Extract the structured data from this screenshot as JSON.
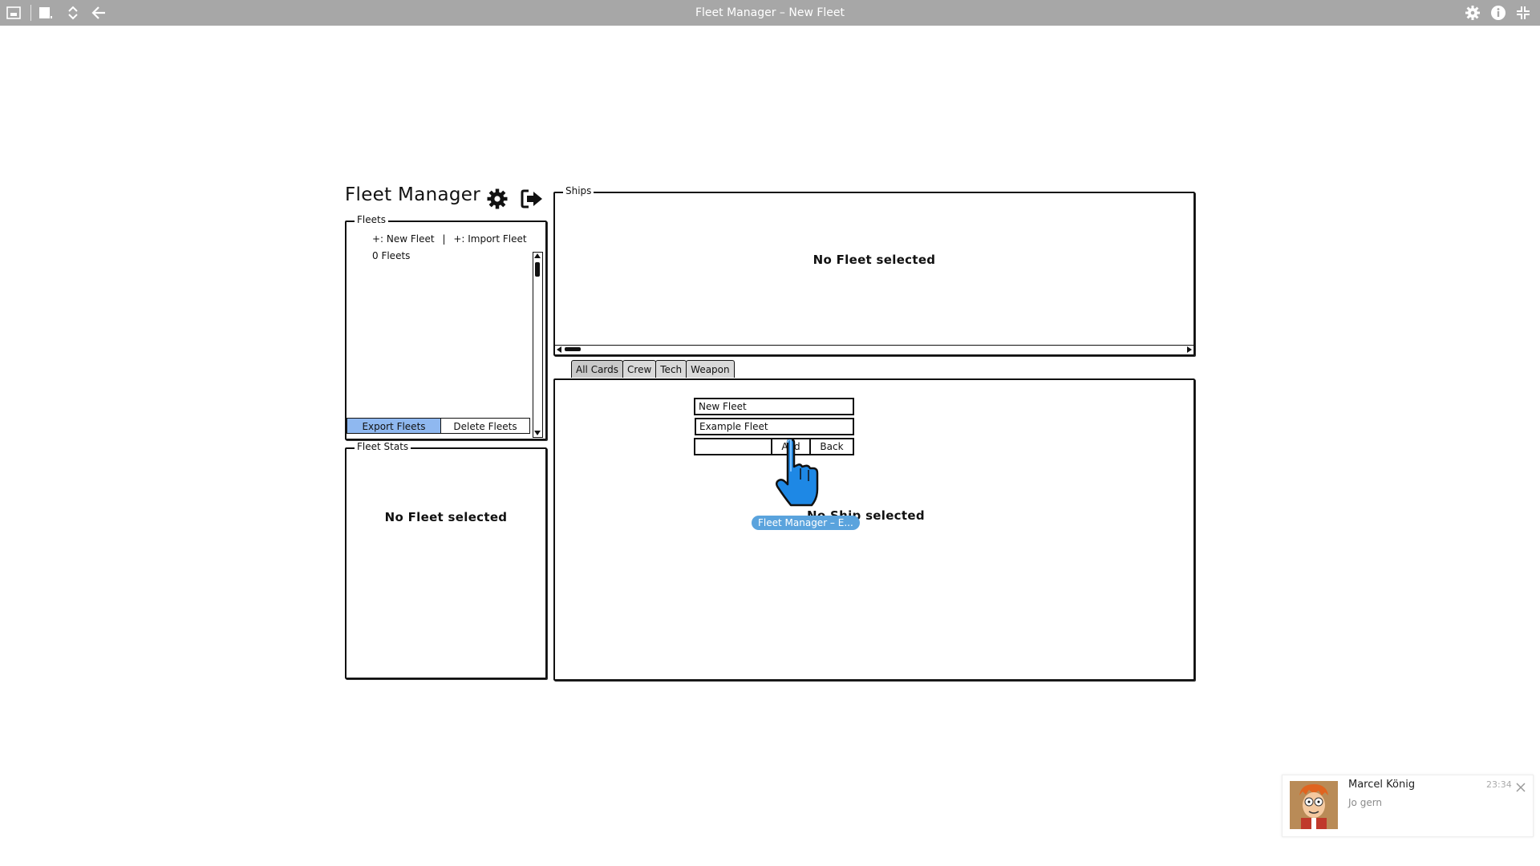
{
  "window": {
    "title": "Fleet Manager – New Fleet",
    "icons": [
      "window-menu-icon",
      "window-list-icon",
      "reorder-icon",
      "back-arrow-icon",
      "settings-icon",
      "info-icon",
      "collapse-icon"
    ]
  },
  "app": {
    "title": "Fleet Manager",
    "settings_icon": "gear-icon",
    "logout_icon": "logout-icon"
  },
  "fleets": {
    "legend": "Fleets",
    "new_fleet_link": "+: New Fleet",
    "separator": "|",
    "import_fleet_link": "+: Import Fleet",
    "count": "0 Fleets",
    "export_button": "Export Fleets",
    "delete_button": "Delete Fleets"
  },
  "fleet_stats": {
    "legend": "Fleet Stats",
    "empty_message": "No Fleet selected"
  },
  "ships": {
    "legend": "Ships",
    "empty_message": "No Fleet selected"
  },
  "tabs": [
    "All Cards",
    "Crew",
    "Tech",
    "Weapon"
  ],
  "cards": {
    "empty_message": "No Ship selected",
    "form": {
      "name_value": "New Fleet",
      "description_value": "Example Fleet",
      "extra_value": "",
      "add_button": "Add",
      "back_button": "Back"
    }
  },
  "drag_tooltip": "Fleet Manager – E...",
  "notification": {
    "sender": "Marcel König",
    "message": "Jo gern",
    "time": "23:34"
  },
  "colors": {
    "titlebar": "#a7a7a7",
    "export_button": "#8fb8f0",
    "cursor": "#1e88e5",
    "drag_tooltip": "#5aa3dd"
  }
}
